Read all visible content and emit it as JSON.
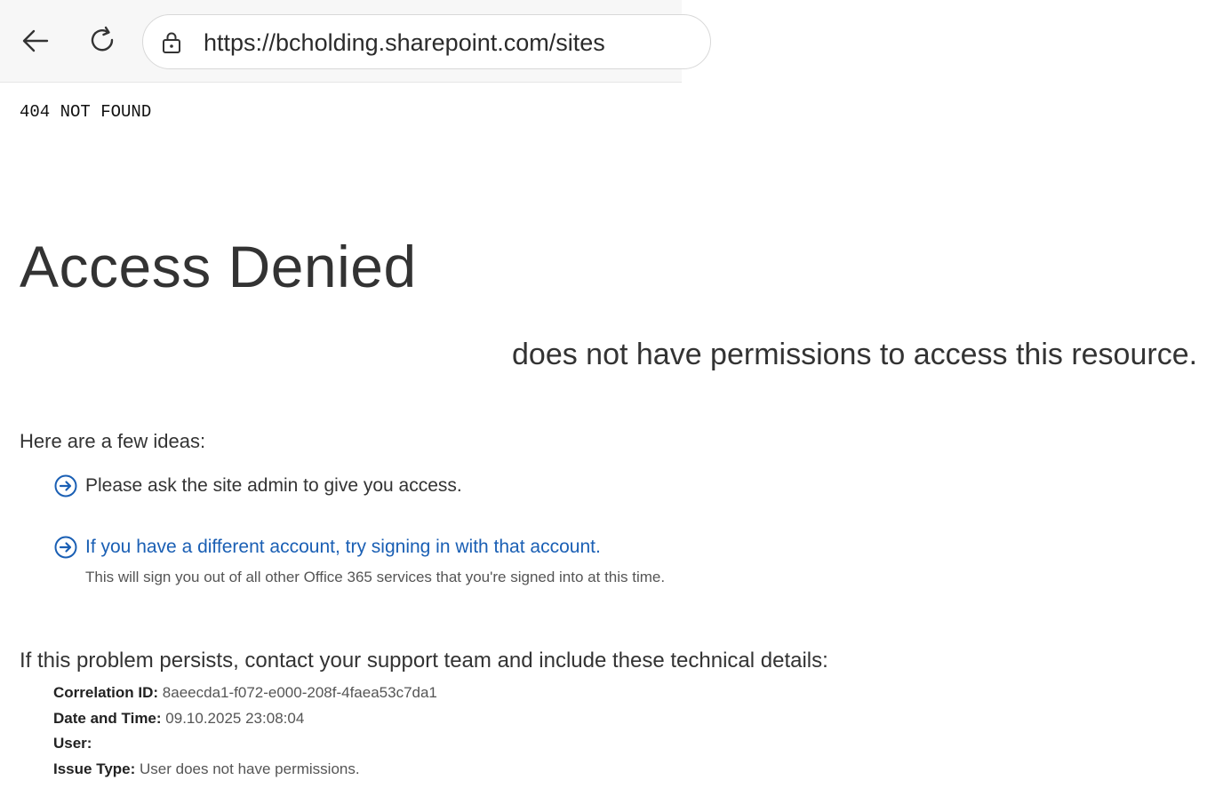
{
  "browser": {
    "url": "https://bcholding.sharepoint.com/sites",
    "body_text": "404 NOT FOUND",
    "icons": [
      "back-arrow-icon",
      "reload-icon",
      "lock-icon"
    ]
  },
  "access": {
    "title": "Access Denied",
    "permission_message": "does not have permissions to access this resource.",
    "ideas_heading": "Here are a few ideas:",
    "ideas": [
      {
        "text": "Please ask the site admin to give you access."
      },
      {
        "text": "If you have a different account, try signing in with that account.",
        "subtext": "This will sign you out of all other Office 365 services that you're signed into at this time."
      }
    ],
    "persist_text": "If this problem persists, contact your support team and include these technical details:",
    "details": {
      "correlation_label": "Correlation ID:",
      "correlation_value": "8aeecda1-f072-e000-208f-4faea53c7da1",
      "datetime_label": "Date and Time:",
      "datetime_value": "09.10.2025 23:08:04",
      "user_label": "User:",
      "user_value": "",
      "issue_label": "Issue Type:",
      "issue_value": "User does not have permissions."
    }
  },
  "colors": {
    "link": "#1a5fb4",
    "text": "#333333",
    "toolbar": "#f7f7f7"
  }
}
